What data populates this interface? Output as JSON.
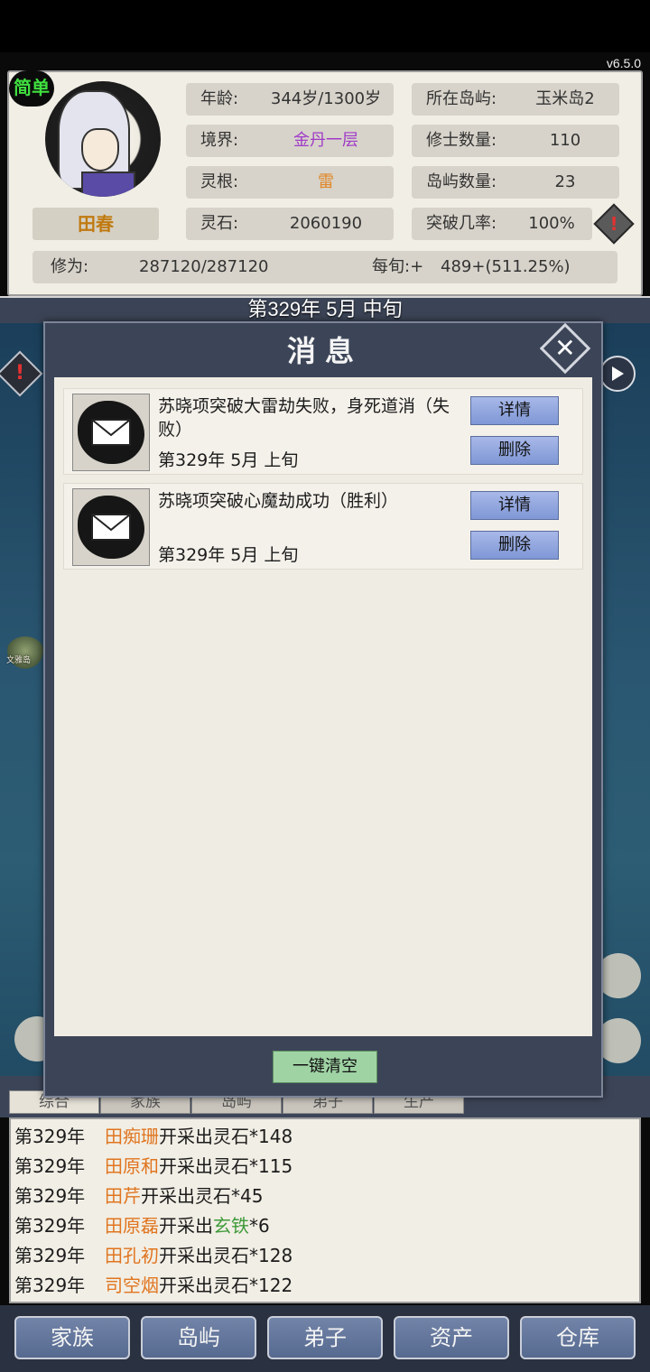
{
  "version": "v6.5.0",
  "difficulty": "简单",
  "character": {
    "name": "田春",
    "age_label": "年龄:",
    "age_value": "344岁/1300岁",
    "realm_label": "境界:",
    "realm_value": "金丹一层",
    "root_label": "灵根:",
    "root_value": "雷",
    "stones_label": "灵石:",
    "stones_value": "2060190",
    "island_label": "所在岛屿:",
    "island_value": "玉米岛2",
    "cultivators_label": "修士数量:",
    "cultivators_value": "110",
    "islands_label": "岛屿数量:",
    "islands_value": "23",
    "breakthrough_label": "突破几率:",
    "breakthrough_value": "100%",
    "cultivation_label": "修为:",
    "cultivation_value": "287120/287120",
    "per_period_label": "每旬:+",
    "per_period_value": "489+(511.25%)"
  },
  "current_date": "第329年 5月 中旬",
  "map": {
    "island_label": "文雅岛"
  },
  "dialog": {
    "title": "消息",
    "messages": [
      {
        "text": "苏晓项突破大雷劫失败，身死道消（失败）",
        "date": "第329年 5月 上旬",
        "detail_label": "详情",
        "delete_label": "删除"
      },
      {
        "text": "苏晓项突破心魔劫成功（胜利）",
        "date": "第329年 5月 上旬",
        "detail_label": "详情",
        "delete_label": "删除"
      }
    ],
    "clear_all_label": "一键清空"
  },
  "log_tabs": [
    "综合",
    "家族",
    "岛屿",
    "弟子",
    "生产"
  ],
  "log": [
    {
      "year": "第329年",
      "name": "田痴珊",
      "action": "开采出",
      "item": "灵石",
      "qty": "*148",
      "item_color": "default"
    },
    {
      "year": "第329年",
      "name": "田原和",
      "action": "开采出",
      "item": "灵石",
      "qty": "*115",
      "item_color": "default"
    },
    {
      "year": "第329年",
      "name": "田芹",
      "action": "开采出",
      "item": "灵石",
      "qty": "*45",
      "item_color": "default"
    },
    {
      "year": "第329年",
      "name": "田原磊",
      "action": "开采出",
      "item": "玄铁",
      "qty": "*6",
      "item_color": "green"
    },
    {
      "year": "第329年",
      "name": "田孔初",
      "action": "开采出",
      "item": "灵石",
      "qty": "*128",
      "item_color": "default"
    },
    {
      "year": "第329年",
      "name": "司空烟",
      "action": "开采出",
      "item": "灵石",
      "qty": "*122",
      "item_color": "default"
    }
  ],
  "bottom_nav": [
    "家族",
    "岛屿",
    "弟子",
    "资产",
    "仓库"
  ],
  "colors": {
    "accent_name": "#c07a10",
    "realm": "#a03ac8",
    "root": "#e0882a",
    "log_name": "#e07520",
    "log_rare": "#3f9a3a",
    "dialog_bg": "#3c4557"
  }
}
